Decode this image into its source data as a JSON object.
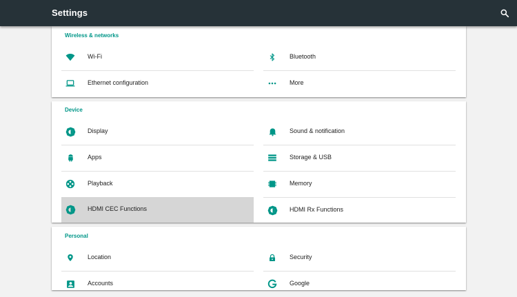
{
  "appbar": {
    "title": "Settings",
    "search_icon": "search-icon"
  },
  "colors": {
    "appbar": "#263238",
    "accent": "#009688",
    "selected": "#d6d6d6"
  },
  "categories": [
    {
      "title": "Wireless & networks",
      "items": [
        {
          "label": "Wi-Fi",
          "icon": "wifi-icon"
        },
        {
          "label": "Bluetooth",
          "icon": "bluetooth-icon"
        },
        {
          "label": "Ethernet configuration",
          "icon": "laptop-icon"
        },
        {
          "label": "More",
          "icon": "more-icon"
        }
      ]
    },
    {
      "title": "Device",
      "items": [
        {
          "label": "Display",
          "icon": "brightness-icon"
        },
        {
          "label": "Sound & notification",
          "icon": "bell-icon"
        },
        {
          "label": "Apps",
          "icon": "android-icon"
        },
        {
          "label": "Storage & USB",
          "icon": "storage-icon"
        },
        {
          "label": "Playback",
          "icon": "reel-icon"
        },
        {
          "label": "Memory",
          "icon": "memory-icon"
        },
        {
          "label": "HDMI CEC Functions",
          "icon": "brightness-icon",
          "selected": true
        },
        {
          "label": "HDMI Rx Functions",
          "icon": "brightness-icon"
        }
      ]
    },
    {
      "title": "Personal",
      "items": [
        {
          "label": "Location",
          "icon": "location-pin-icon"
        },
        {
          "label": "Security",
          "icon": "lock-icon"
        },
        {
          "label": "Accounts",
          "icon": "account-box-icon"
        },
        {
          "label": "Google",
          "icon": "google-icon"
        }
      ]
    }
  ]
}
